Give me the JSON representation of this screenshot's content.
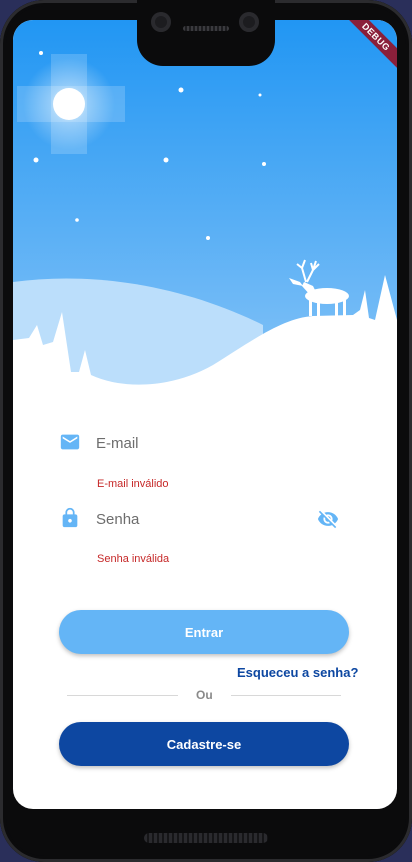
{
  "debug_banner": "DEBUG",
  "colors": {
    "sky_top": "#2196f3",
    "sky_bottom": "#90caf9",
    "accent": "#64b5f6",
    "primary": "#0d47a1",
    "error": "#c62828"
  },
  "form": {
    "email": {
      "placeholder": "E-mail",
      "value": "",
      "icon": "email-icon",
      "error": "E-mail inválido"
    },
    "password": {
      "placeholder": "Senha",
      "value": "",
      "icon": "lock-icon",
      "toggle_icon": "visibility-off-icon",
      "error": "Senha inválida"
    },
    "login_label": "Entrar",
    "forgot_label": "Esqueceu a senha?",
    "divider_label": "Ou",
    "signup_label": "Cadastre-se"
  }
}
